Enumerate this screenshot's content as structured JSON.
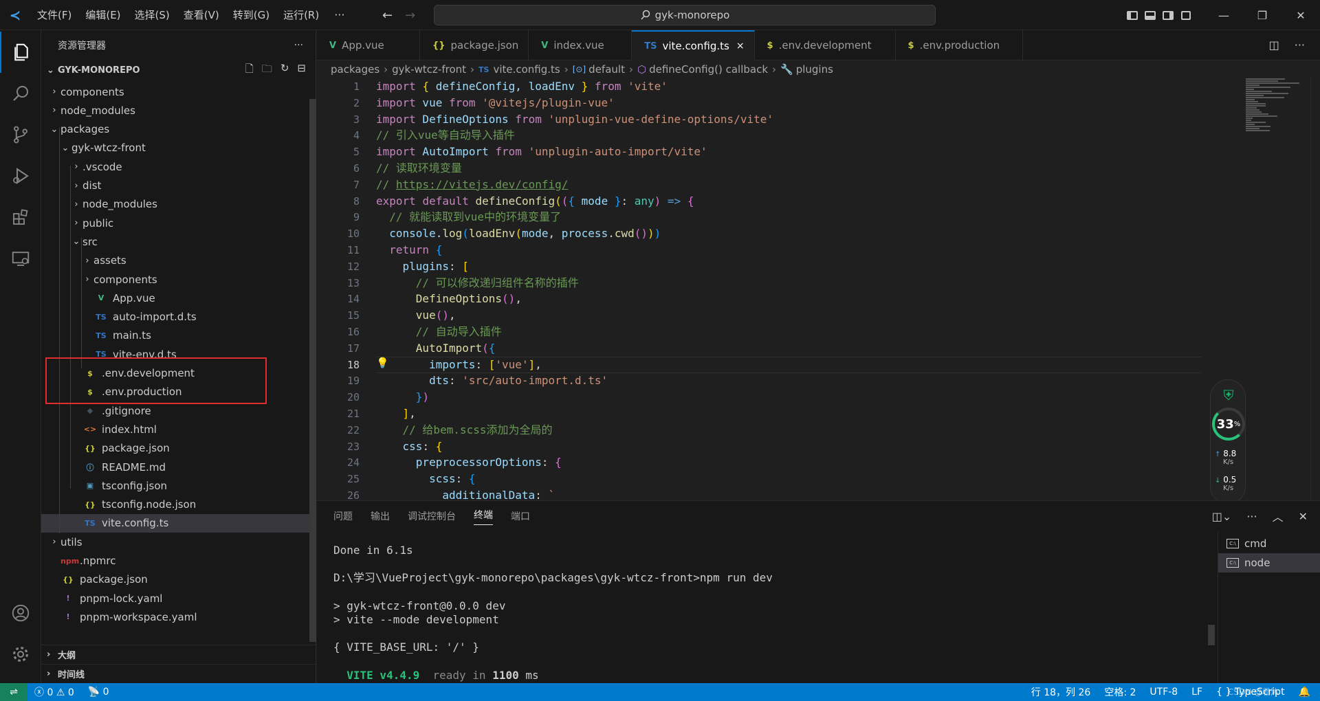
{
  "titlebar": {
    "menu": [
      "文件(F)",
      "编辑(E)",
      "选择(S)",
      "查看(V)",
      "转到(G)",
      "运行(R)"
    ],
    "more": "···",
    "search": "gyk-monorepo"
  },
  "sidebar": {
    "title": "资源管理器",
    "more": "···",
    "root": "GYK-MONOREPO",
    "tree": [
      {
        "label": "components",
        "twisty": "›",
        "icon": "",
        "depth": 1
      },
      {
        "label": "node_modules",
        "twisty": "›",
        "icon": "",
        "depth": 1
      },
      {
        "label": "packages",
        "twisty": "⌄",
        "icon": "",
        "depth": 1
      },
      {
        "label": "gyk-wtcz-front",
        "twisty": "⌄",
        "icon": "",
        "depth": 2
      },
      {
        "label": ".vscode",
        "twisty": "›",
        "icon": "",
        "depth": 3
      },
      {
        "label": "dist",
        "twisty": "›",
        "icon": "",
        "depth": 3
      },
      {
        "label": "node_modules",
        "twisty": "›",
        "icon": "",
        "depth": 3
      },
      {
        "label": "public",
        "twisty": "›",
        "icon": "",
        "depth": 3
      },
      {
        "label": "src",
        "twisty": "⌄",
        "icon": "",
        "depth": 3
      },
      {
        "label": "assets",
        "twisty": "›",
        "icon": "",
        "depth": 4
      },
      {
        "label": "components",
        "twisty": "›",
        "icon": "",
        "depth": 4
      },
      {
        "label": "App.vue",
        "twisty": "",
        "icon": "V",
        "iconColor": "#41b883",
        "depth": 4
      },
      {
        "label": "auto-import.d.ts",
        "twisty": "",
        "icon": "TS",
        "iconColor": "#3178c6",
        "depth": 4
      },
      {
        "label": "main.ts",
        "twisty": "",
        "icon": "TS",
        "iconColor": "#3178c6",
        "depth": 4
      },
      {
        "label": "vite-env.d.ts",
        "twisty": "",
        "icon": "TS",
        "iconColor": "#3178c6",
        "depth": 4
      },
      {
        "label": ".env.development",
        "twisty": "",
        "icon": "$",
        "iconColor": "#cbcb41",
        "depth": 3
      },
      {
        "label": ".env.production",
        "twisty": "",
        "icon": "$",
        "iconColor": "#cbcb41",
        "depth": 3
      },
      {
        "label": ".gitignore",
        "twisty": "",
        "icon": "◆",
        "iconColor": "#41535b",
        "depth": 3
      },
      {
        "label": "index.html",
        "twisty": "",
        "icon": "<>",
        "iconColor": "#e37933",
        "depth": 3
      },
      {
        "label": "package.json",
        "twisty": "",
        "icon": "{}",
        "iconColor": "#cbcb41",
        "depth": 3
      },
      {
        "label": "README.md",
        "twisty": "",
        "icon": "ⓘ",
        "iconColor": "#519aba",
        "depth": 3
      },
      {
        "label": "tsconfig.json",
        "twisty": "",
        "icon": "▣",
        "iconColor": "#519aba",
        "depth": 3
      },
      {
        "label": "tsconfig.node.json",
        "twisty": "",
        "icon": "{}",
        "iconColor": "#cbcb41",
        "depth": 3
      },
      {
        "label": "vite.config.ts",
        "twisty": "",
        "icon": "TS",
        "iconColor": "#3178c6",
        "depth": 3,
        "selected": true
      },
      {
        "label": "utils",
        "twisty": "›",
        "icon": "",
        "depth": 1
      },
      {
        "label": ".npmrc",
        "twisty": "",
        "icon": "npm",
        "iconColor": "#cb3837",
        "depth": 1
      },
      {
        "label": "package.json",
        "twisty": "",
        "icon": "{}",
        "iconColor": "#cbcb41",
        "depth": 1
      },
      {
        "label": "pnpm-lock.yaml",
        "twisty": "",
        "icon": "!",
        "iconColor": "#a074c4",
        "depth": 1
      },
      {
        "label": "pnpm-workspace.yaml",
        "twisty": "",
        "icon": "!",
        "iconColor": "#a074c4",
        "depth": 1
      }
    ],
    "outline": "大纲",
    "timeline": "时间线"
  },
  "tabs": [
    {
      "label": "App.vue",
      "icon": "V",
      "iconColor": "#41b883"
    },
    {
      "label": "package.json",
      "icon": "{}",
      "iconColor": "#cbcb41"
    },
    {
      "label": "index.vue",
      "icon": "V",
      "iconColor": "#41b883"
    },
    {
      "label": "vite.config.ts",
      "icon": "TS",
      "iconColor": "#3178c6",
      "active": true,
      "close": "×"
    },
    {
      "label": ".env.development",
      "icon": "$",
      "iconColor": "#cbcb41"
    },
    {
      "label": ".env.production",
      "icon": "$",
      "iconColor": "#cbcb41"
    }
  ],
  "breadcrumb": {
    "p1": "packages",
    "p2": "gyk-wtcz-front",
    "p3_icon": "TS",
    "p3": "vite.config.ts",
    "p4": "default",
    "p5": "defineConfig() callback",
    "p6": "plugins",
    "sep": "›"
  },
  "editor": {
    "current_line": 18,
    "lines": [
      [
        {
          "t": "import",
          "c": "kw"
        },
        {
          "t": " "
        },
        {
          "t": "{",
          "c": "b1"
        },
        {
          "t": " defineConfig, loadEnv ",
          "c": "var"
        },
        {
          "t": "}",
          "c": "b1"
        },
        {
          "t": " "
        },
        {
          "t": "from",
          "c": "kw"
        },
        {
          "t": " "
        },
        {
          "t": "'vite'",
          "c": "str"
        }
      ],
      [
        {
          "t": "import",
          "c": "kw"
        },
        {
          "t": " vue ",
          "c": "var"
        },
        {
          "t": "from",
          "c": "kw"
        },
        {
          "t": " "
        },
        {
          "t": "'@vitejs/plugin-vue'",
          "c": "str"
        }
      ],
      [
        {
          "t": "import",
          "c": "kw"
        },
        {
          "t": " DefineOptions ",
          "c": "var"
        },
        {
          "t": "from",
          "c": "kw"
        },
        {
          "t": " "
        },
        {
          "t": "'unplugin-vue-define-options/vite'",
          "c": "str"
        }
      ],
      [
        {
          "t": "// 引入vue等自动导入插件",
          "c": "cm"
        }
      ],
      [
        {
          "t": "import",
          "c": "kw"
        },
        {
          "t": " AutoImport ",
          "c": "var"
        },
        {
          "t": "from",
          "c": "kw"
        },
        {
          "t": " "
        },
        {
          "t": "'unplugin-auto-import/vite'",
          "c": "str"
        }
      ],
      [
        {
          "t": "// 读取环境变量",
          "c": "cm"
        }
      ],
      [
        {
          "t": "// ",
          "c": "cm"
        },
        {
          "t": "https://vitejs.dev/config/",
          "c": "cm url"
        }
      ],
      [
        {
          "t": "export",
          "c": "kw"
        },
        {
          "t": " "
        },
        {
          "t": "default",
          "c": "kw"
        },
        {
          "t": " "
        },
        {
          "t": "defineConfig",
          "c": "fn"
        },
        {
          "t": "(",
          "c": "b1"
        },
        {
          "t": "(",
          "c": "b2"
        },
        {
          "t": "{",
          "c": "b3"
        },
        {
          "t": " mode ",
          "c": "var"
        },
        {
          "t": "}",
          "c": "b3"
        },
        {
          "t": ": ",
          "c": "pu"
        },
        {
          "t": "any",
          "c": "ty"
        },
        {
          "t": ")",
          "c": "b2"
        },
        {
          "t": " "
        },
        {
          "t": "=>",
          "c": "kb"
        },
        {
          "t": " "
        },
        {
          "t": "{",
          "c": "b2"
        }
      ],
      [
        {
          "t": "  "
        },
        {
          "t": "// 就能读取到vue中的环境变量了",
          "c": "cm"
        }
      ],
      [
        {
          "t": "  "
        },
        {
          "t": "console",
          "c": "var"
        },
        {
          "t": ".",
          "c": "pu"
        },
        {
          "t": "log",
          "c": "fn"
        },
        {
          "t": "(",
          "c": "b3"
        },
        {
          "t": "loadEnv",
          "c": "fn"
        },
        {
          "t": "(",
          "c": "b1"
        },
        {
          "t": "mode",
          "c": "var"
        },
        {
          "t": ", ",
          "c": "pu"
        },
        {
          "t": "process",
          "c": "var"
        },
        {
          "t": ".",
          "c": "pu"
        },
        {
          "t": "cwd",
          "c": "fn"
        },
        {
          "t": "(",
          "c": "b2"
        },
        {
          "t": ")",
          "c": "b2"
        },
        {
          "t": ")",
          "c": "b1"
        },
        {
          "t": ")",
          "c": "b3"
        }
      ],
      [
        {
          "t": "  "
        },
        {
          "t": "return",
          "c": "kw"
        },
        {
          "t": " "
        },
        {
          "t": "{",
          "c": "b3"
        }
      ],
      [
        {
          "t": "    "
        },
        {
          "t": "plugins",
          "c": "var"
        },
        {
          "t": ": ",
          "c": "pu"
        },
        {
          "t": "[",
          "c": "b1"
        }
      ],
      [
        {
          "t": "      "
        },
        {
          "t": "// 可以修改递归组件名称的插件",
          "c": "cm"
        }
      ],
      [
        {
          "t": "      "
        },
        {
          "t": "DefineOptions",
          "c": "fn"
        },
        {
          "t": "(",
          "c": "b2"
        },
        {
          "t": ")",
          "c": "b2"
        },
        {
          "t": ",",
          "c": "pu"
        }
      ],
      [
        {
          "t": "      "
        },
        {
          "t": "vue",
          "c": "fn"
        },
        {
          "t": "(",
          "c": "b2"
        },
        {
          "t": ")",
          "c": "b2"
        },
        {
          "t": ",",
          "c": "pu"
        }
      ],
      [
        {
          "t": "      "
        },
        {
          "t": "// 自动导入插件",
          "c": "cm"
        }
      ],
      [
        {
          "t": "      "
        },
        {
          "t": "AutoImport",
          "c": "fn"
        },
        {
          "t": "(",
          "c": "b2"
        },
        {
          "t": "{",
          "c": "b3"
        }
      ],
      [
        {
          "t": "        "
        },
        {
          "t": "imports",
          "c": "var"
        },
        {
          "t": ": ",
          "c": "pu"
        },
        {
          "t": "[",
          "c": "b1"
        },
        {
          "t": "'vue'",
          "c": "str"
        },
        {
          "t": "]",
          "c": "b1"
        },
        {
          "t": ",",
          "c": "pu"
        }
      ],
      [
        {
          "t": "        "
        },
        {
          "t": "dts",
          "c": "var"
        },
        {
          "t": ": ",
          "c": "pu"
        },
        {
          "t": "'src/auto-import.d.ts'",
          "c": "str"
        }
      ],
      [
        {
          "t": "      "
        },
        {
          "t": "}",
          "c": "b3"
        },
        {
          "t": ")",
          "c": "b2"
        }
      ],
      [
        {
          "t": "    "
        },
        {
          "t": "]",
          "c": "b1"
        },
        {
          "t": ",",
          "c": "pu"
        }
      ],
      [
        {
          "t": "    "
        },
        {
          "t": "// 给bem.scss添加为全局的",
          "c": "cm"
        }
      ],
      [
        {
          "t": "    "
        },
        {
          "t": "css",
          "c": "var"
        },
        {
          "t": ": ",
          "c": "pu"
        },
        {
          "t": "{",
          "c": "b1"
        }
      ],
      [
        {
          "t": "      "
        },
        {
          "t": "preprocessorOptions",
          "c": "var"
        },
        {
          "t": ": ",
          "c": "pu"
        },
        {
          "t": "{",
          "c": "b2"
        }
      ],
      [
        {
          "t": "        "
        },
        {
          "t": "scss",
          "c": "var"
        },
        {
          "t": ": ",
          "c": "pu"
        },
        {
          "t": "{",
          "c": "b3"
        }
      ],
      [
        {
          "t": "          "
        },
        {
          "t": "additionalData",
          "c": "var"
        },
        {
          "t": ": ",
          "c": "pu"
        },
        {
          "t": "`",
          "c": "str"
        }
      ]
    ]
  },
  "network_widget": {
    "percent": "33",
    "percent_unit": "%",
    "up": "8.8",
    "up_unit": "K/s",
    "down": "0.5",
    "down_unit": "K/s"
  },
  "panel": {
    "tabs": [
      "问题",
      "输出",
      "调试控制台",
      "终端",
      "端口"
    ],
    "active_tab": "终端",
    "terminal_lines": [
      {
        "text": "Done in 6.1s"
      },
      {
        "text": ""
      },
      {
        "text": "D:\\学习\\VueProject\\gyk-monorepo\\packages\\gyk-wtcz-front>npm run dev"
      },
      {
        "text": ""
      },
      {
        "text": "> gyk-wtcz-front@0.0.0 dev"
      },
      {
        "text": "> vite --mode development"
      },
      {
        "text": ""
      },
      {
        "text": "{ VITE_BASE_URL: '/' }"
      },
      {
        "text": ""
      }
    ],
    "vite_line": {
      "name": "VITE",
      "version": "v4.4.9",
      "ready": "ready in",
      "time": "1100",
      "unit": "ms"
    },
    "terminals": [
      {
        "label": "cmd"
      },
      {
        "label": "node",
        "active": true
      }
    ]
  },
  "statusbar": {
    "errors": "0",
    "warnings": "0",
    "ports": "0",
    "position": "行 18，列 26",
    "spaces": "空格: 2",
    "encoding": "UTF-8",
    "eol": "LF",
    "language": "TypeScript",
    "watermark": "CSDN @君沐"
  }
}
